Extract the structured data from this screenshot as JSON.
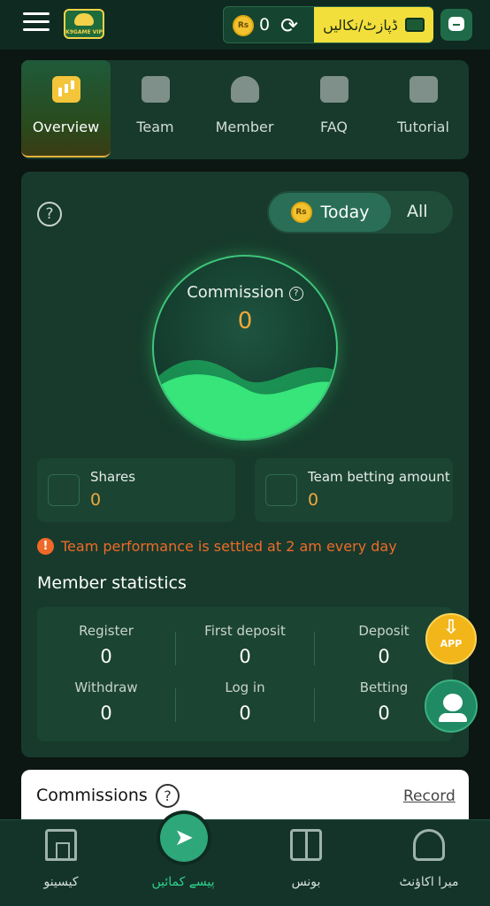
{
  "header": {
    "balance": "0",
    "currency_symbol": "Rs",
    "deposit_label": "ڈپازٹ/نکالیں",
    "logo_text": "K9GAME VIP"
  },
  "tabs": [
    {
      "label": "Overview",
      "icon": "bar-chart-icon",
      "active": true
    },
    {
      "label": "Team",
      "icon": "crown-icon",
      "active": false
    },
    {
      "label": "Member",
      "icon": "members-icon",
      "active": false
    },
    {
      "label": "FAQ",
      "icon": "faq-icon",
      "active": false
    },
    {
      "label": "Tutorial",
      "icon": "tutorial-icon",
      "active": false
    }
  ],
  "overview": {
    "period_toggle": {
      "today": "Today",
      "all": "All",
      "selected": "Today"
    },
    "commission_label": "Commission",
    "commission_value": "0",
    "shares": {
      "label": "Shares",
      "value": "0"
    },
    "team_betting": {
      "label": "Team betting amount",
      "value": "0"
    },
    "notice": "Team performance is settled at 2 am every day",
    "member_stats_title": "Member statistics",
    "member_stats": [
      {
        "label": "Register",
        "value": "0"
      },
      {
        "label": "First deposit",
        "value": "0"
      },
      {
        "label": "Deposit",
        "value": "0"
      },
      {
        "label": "Withdraw",
        "value": "0"
      },
      {
        "label": "Log in",
        "value": "0"
      },
      {
        "label": "Betting",
        "value": "0"
      }
    ]
  },
  "floating": {
    "app_label": "APP"
  },
  "commissions": {
    "title": "Commissions",
    "record_label": "Record"
  },
  "bottom_nav": [
    {
      "label": "کیسینو",
      "icon": "casino-home-icon",
      "active": false
    },
    {
      "label": "پیسے کمائیں",
      "icon": "paper-plane-icon",
      "active": true
    },
    {
      "label": "بونس",
      "icon": "gift-icon",
      "active": false
    },
    {
      "label": "میرا اکاؤنٹ",
      "icon": "account-icon",
      "active": false
    }
  ],
  "colors": {
    "accent_green": "#2fd28c",
    "value_orange": "#f1a83a",
    "notice_orange": "#ef6a28",
    "deposit_yellow": "#f3df3c"
  }
}
